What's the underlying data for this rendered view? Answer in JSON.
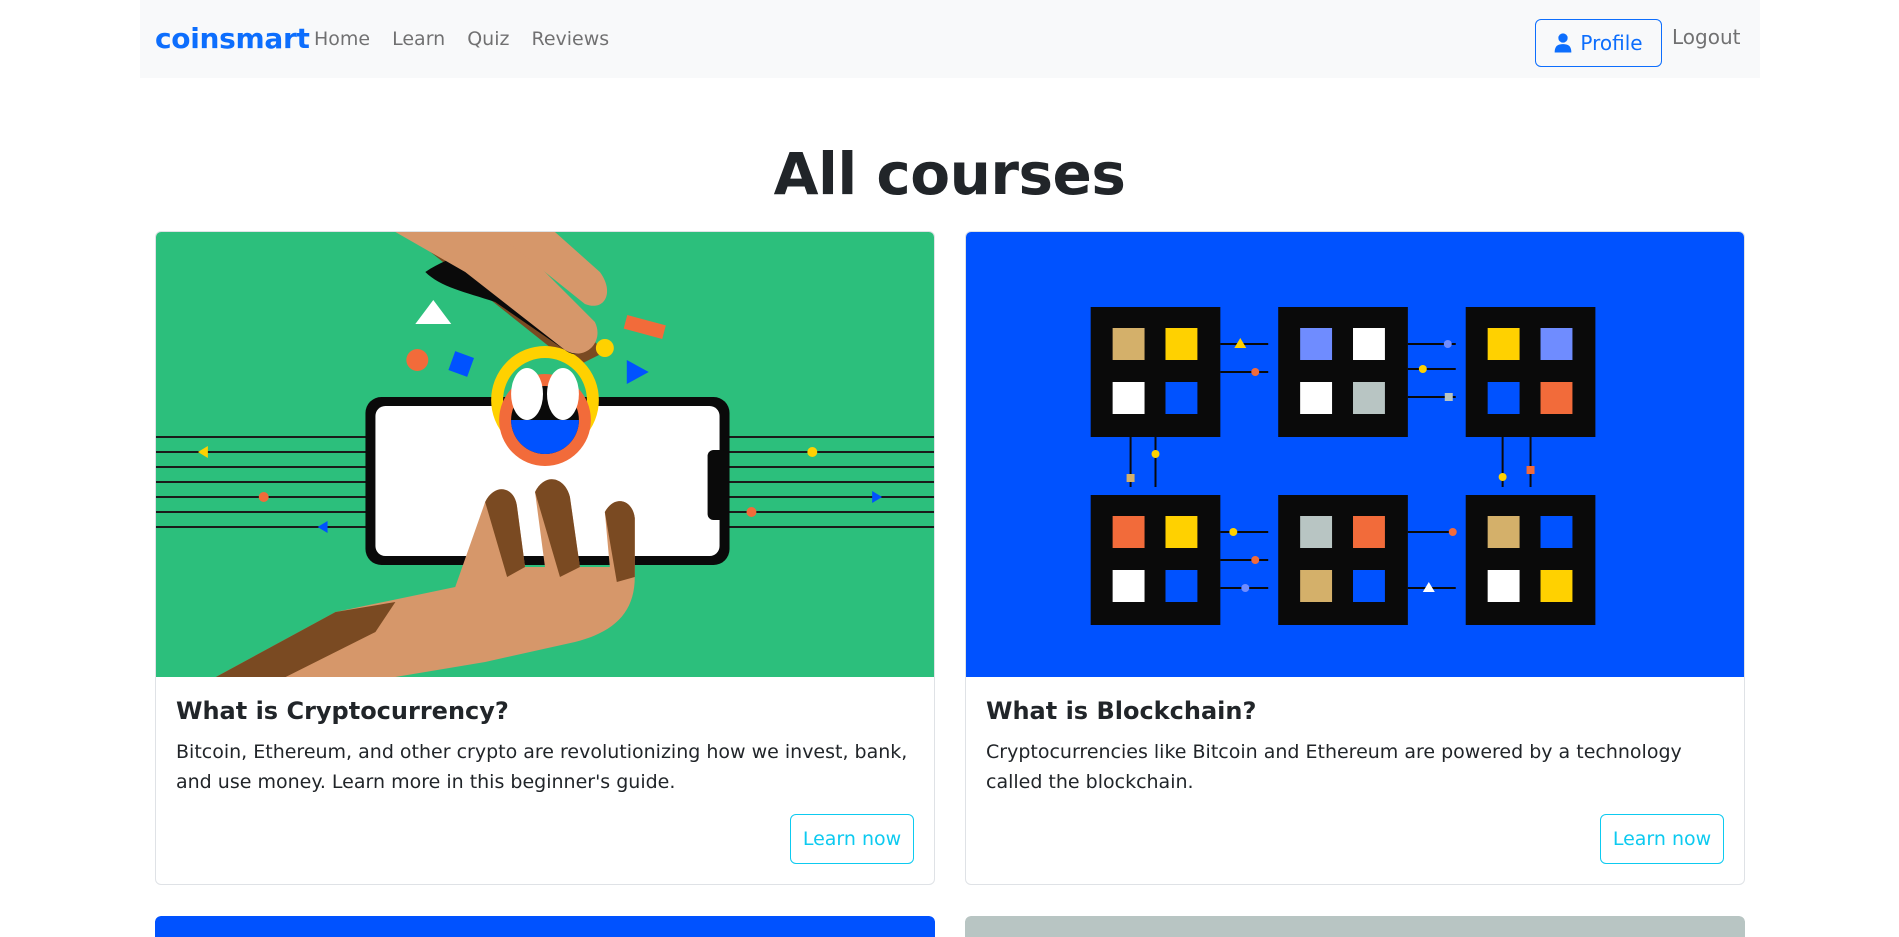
{
  "navbar": {
    "brand": "coinsmart",
    "links": [
      "Home",
      "Learn",
      "Quiz",
      "Reviews"
    ],
    "profile_label": "Profile",
    "logout_label": "Logout"
  },
  "page": {
    "title": "All courses"
  },
  "courses": [
    {
      "title": "What is Cryptocurrency?",
      "description": "Bitcoin, Ethereum, and other crypto are revolutionizing how we invest, bank, and use money. Learn more in this beginner's guide.",
      "button_label": "Learn now",
      "image_bg": "#2cbf7c"
    },
    {
      "title": "What is Blockchain?",
      "description": "Cryptocurrencies like Bitcoin and Ethereum are powered by a technology called the blockchain.",
      "button_label": "Learn now",
      "image_bg": "#0052ff"
    },
    {
      "image_bg": "#0052ff"
    },
    {
      "image_bg": "#b8c5c3"
    }
  ],
  "colors": {
    "brand": "#0d6efd",
    "info": "#0dcaf0",
    "navbar_bg": "#f8f9fa"
  }
}
